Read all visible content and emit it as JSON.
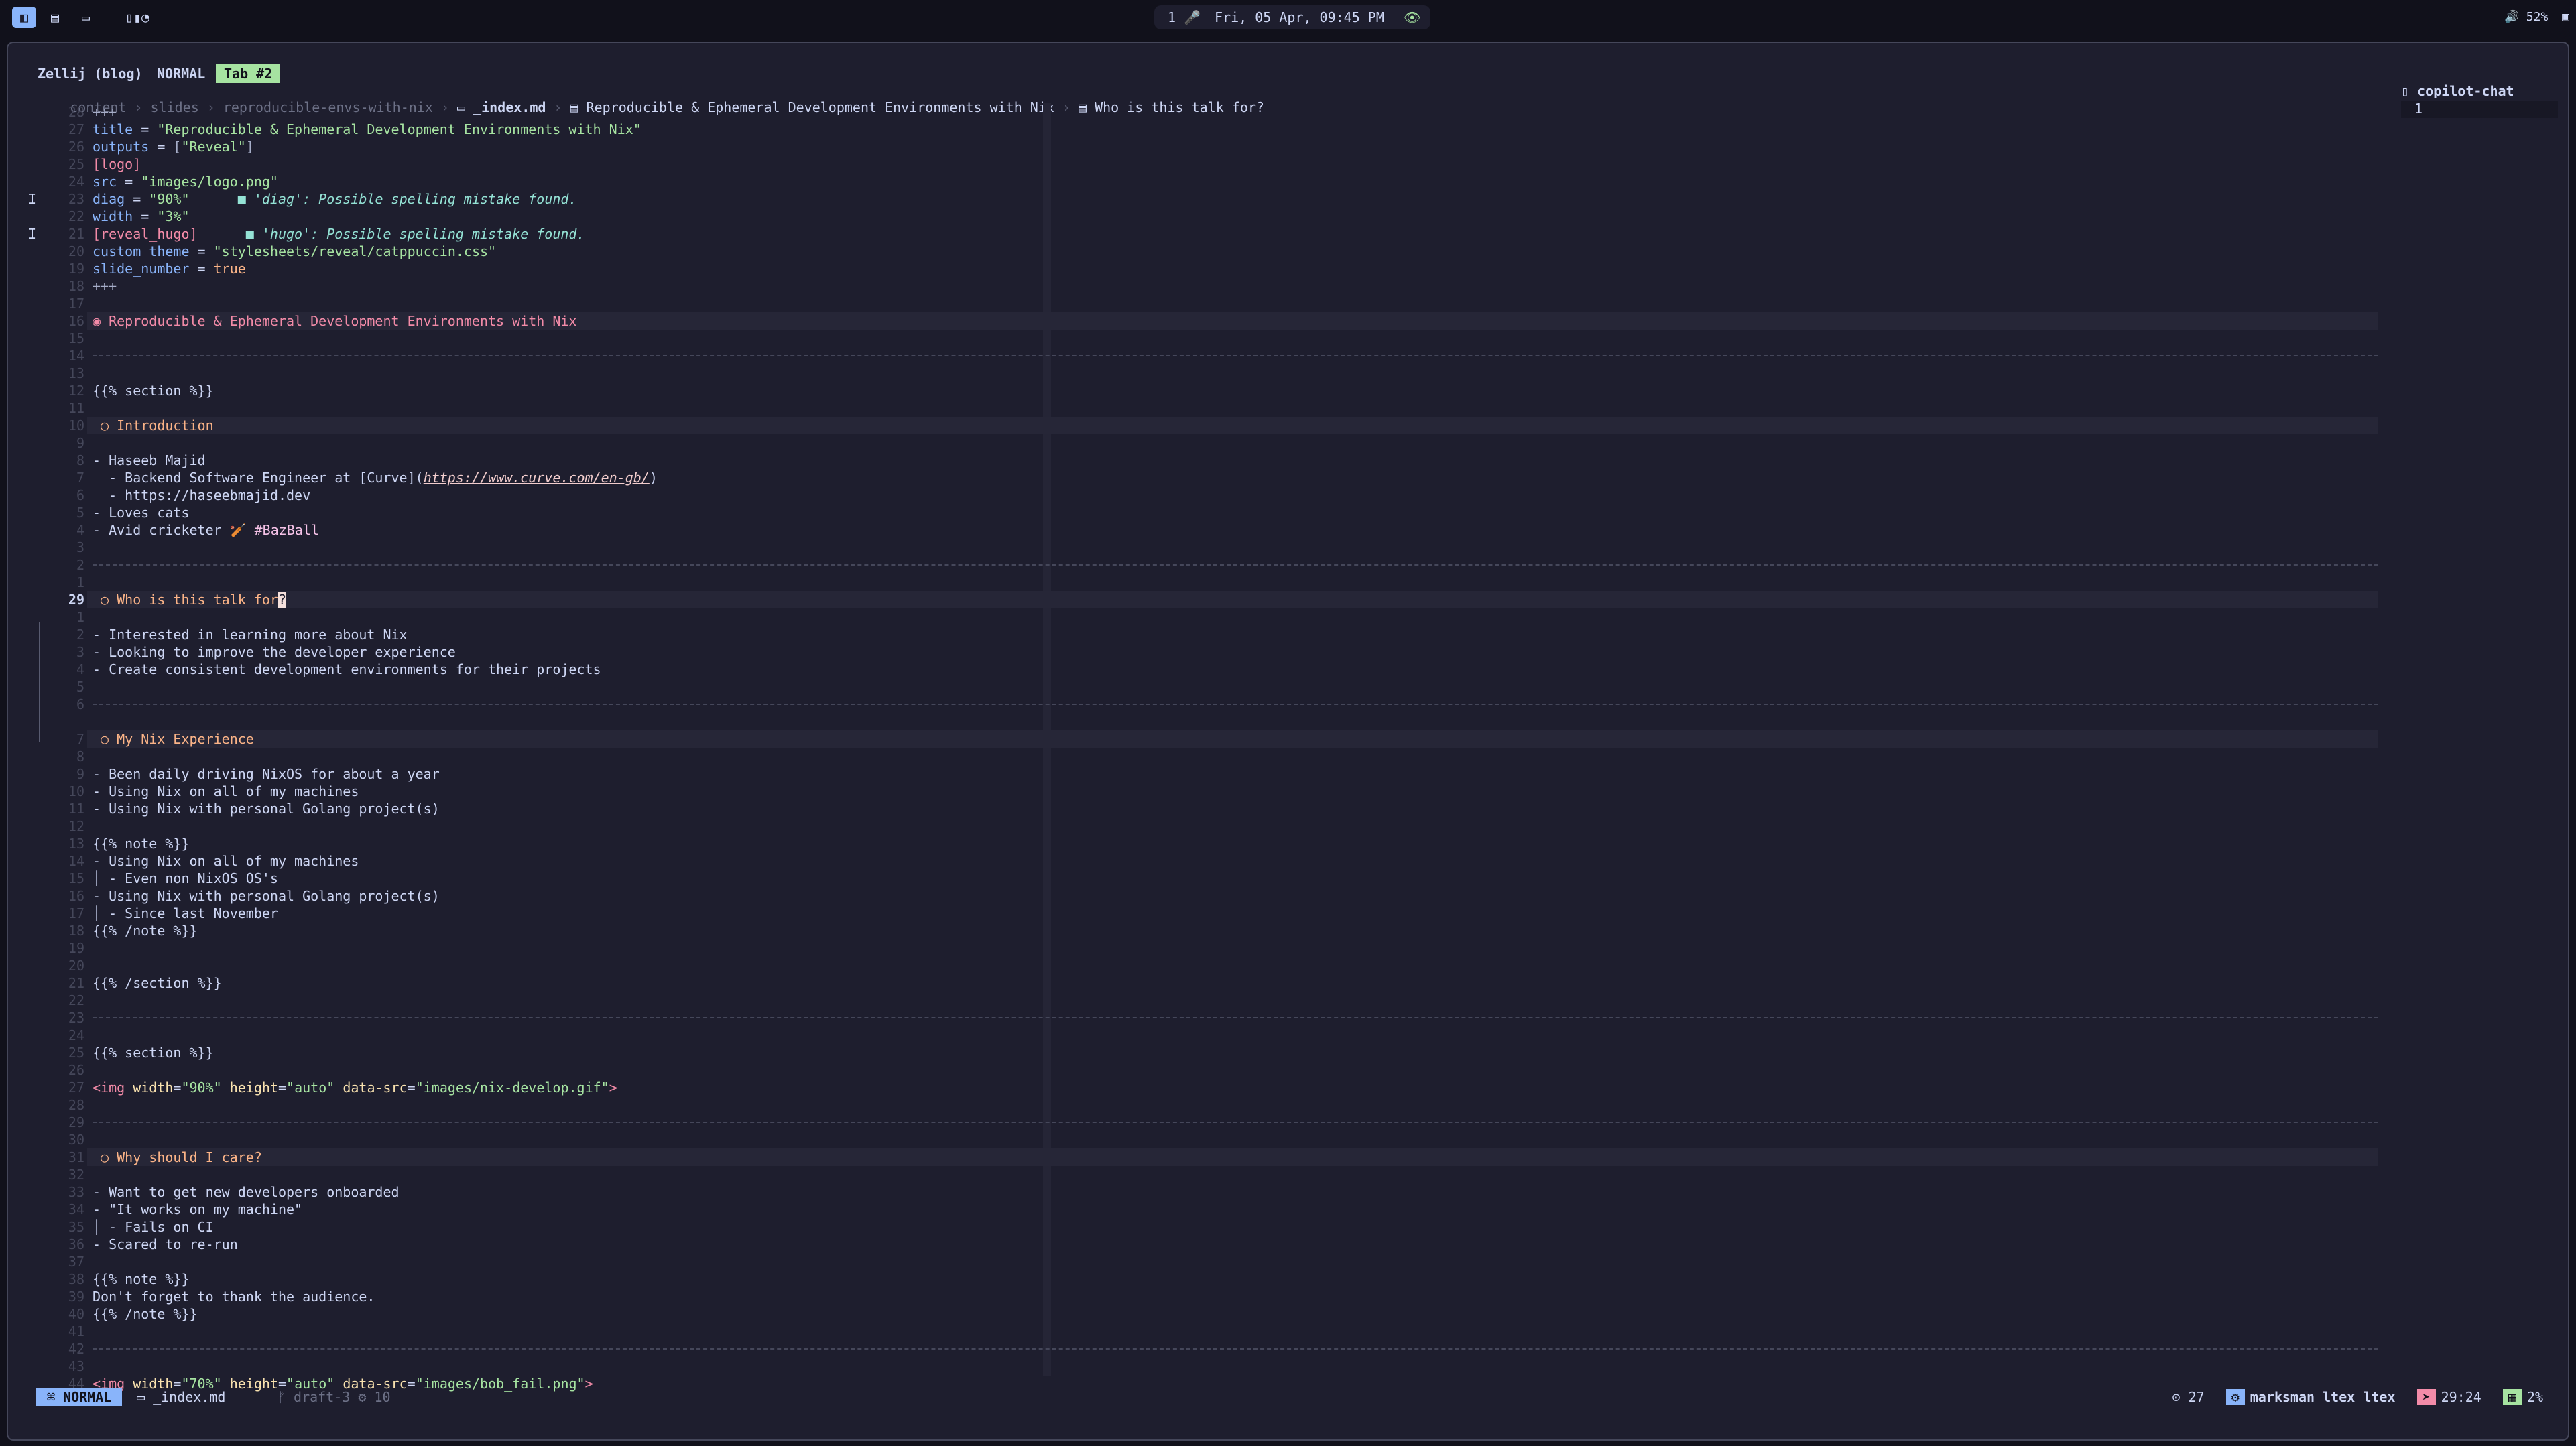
{
  "topbar": {
    "workspaces": [
      "◧",
      "▤",
      "▭",
      "▯▮◔"
    ],
    "pill": {
      "workspace": "1",
      "mic_icon": "🎤",
      "datetime": "Fri, 05 Apr, 09:45 PM",
      "eye_icon": "👁"
    },
    "volume": "52%",
    "tray_icon": "▣"
  },
  "zellij": {
    "session": "Zellij (blog)",
    "mode": "NORMAL",
    "tab": "Tab #2"
  },
  "breadcrumb": [
    "content",
    "slides",
    "reproducible-envs-with-nix",
    "_index.md",
    "Reproducible & Ephemeral Development Environments with Nix",
    "Who is this talk for?"
  ],
  "copilot": {
    "title": "copilot-chat",
    "line": "1"
  },
  "editor": {
    "current_line": "29",
    "lines": [
      {
        "ln": "28",
        "segments": [
          {
            "t": "+++",
            "c": "dim"
          }
        ]
      },
      {
        "ln": "27",
        "segments": [
          {
            "t": "title",
            "c": "key"
          },
          {
            "t": " = ",
            "c": ""
          },
          {
            "t": "\"Reproducible & Ephemeral Development Environments with Nix\"",
            "c": "str"
          }
        ]
      },
      {
        "ln": "26",
        "segments": [
          {
            "t": "outputs",
            "c": "key"
          },
          {
            "t": " = ",
            "c": ""
          },
          {
            "t": "[",
            "c": "dim"
          },
          {
            "t": "\"Reveal\"",
            "c": "str"
          },
          {
            "t": "]",
            "c": "dim"
          }
        ]
      },
      {
        "ln": "25",
        "segments": [
          {
            "t": "[logo]",
            "c": "br"
          }
        ]
      },
      {
        "ln": "24",
        "segments": [
          {
            "t": "src",
            "c": "key"
          },
          {
            "t": " = ",
            "c": ""
          },
          {
            "t": "\"images/logo.png\"",
            "c": "str"
          }
        ]
      },
      {
        "ln": "23",
        "sign": "I",
        "segments": [
          {
            "t": "diag",
            "c": "key"
          },
          {
            "t": " = ",
            "c": ""
          },
          {
            "t": "\"90%\"",
            "c": "str"
          },
          {
            "t": "      ■ 'diag': Possible spelling mistake found.",
            "c": "diag"
          }
        ]
      },
      {
        "ln": "22",
        "segments": [
          {
            "t": "width",
            "c": "key"
          },
          {
            "t": " = ",
            "c": ""
          },
          {
            "t": "\"3%\"",
            "c": "str"
          }
        ]
      },
      {
        "ln": "21",
        "sign": "I",
        "segments": [
          {
            "t": "[reveal_hugo]",
            "c": "br"
          },
          {
            "t": "      ■ 'hugo': Possible spelling mistake found.",
            "c": "diag"
          }
        ]
      },
      {
        "ln": "20",
        "segments": [
          {
            "t": "custom_theme",
            "c": "key"
          },
          {
            "t": " = ",
            "c": ""
          },
          {
            "t": "\"stylesheets/reveal/catppuccin.css\"",
            "c": "str"
          }
        ]
      },
      {
        "ln": "19",
        "segments": [
          {
            "t": "slide_number",
            "c": "key"
          },
          {
            "t": " = ",
            "c": ""
          },
          {
            "t": "true",
            "c": "bool"
          }
        ]
      },
      {
        "ln": "18",
        "segments": [
          {
            "t": "+++",
            "c": "dim"
          }
        ]
      },
      {
        "ln": "17",
        "segments": []
      },
      {
        "ln": "16",
        "hl": true,
        "segments": [
          {
            "t": "◉ Reproducible & Ephemeral Development Environments with Nix",
            "c": "h1"
          }
        ]
      },
      {
        "ln": "15",
        "segments": []
      },
      {
        "ln": "14",
        "rule": true,
        "segments": []
      },
      {
        "ln": "13",
        "segments": []
      },
      {
        "ln": "12",
        "segments": [
          {
            "t": "{{% section %}}",
            "c": ""
          }
        ]
      },
      {
        "ln": "11",
        "segments": []
      },
      {
        "ln": "10",
        "hl": true,
        "segments": [
          {
            "t": " ○ Introduction",
            "c": "h2"
          }
        ]
      },
      {
        "ln": "9",
        "segments": []
      },
      {
        "ln": "8",
        "segments": [
          {
            "t": "- Haseeb Majid",
            "c": ""
          }
        ]
      },
      {
        "ln": "7",
        "segments": [
          {
            "t": "  - Backend Software Engineer at [Curve](",
            "c": ""
          },
          {
            "t": "https://www.curve.com/en-gb/",
            "c": "link"
          },
          {
            "t": ")",
            "c": ""
          }
        ]
      },
      {
        "ln": "6",
        "segments": [
          {
            "t": "  - https://haseebmajid.dev",
            "c": ""
          }
        ]
      },
      {
        "ln": "5",
        "segments": [
          {
            "t": "- Loves cats",
            "c": ""
          }
        ]
      },
      {
        "ln": "4",
        "segments": [
          {
            "t": "- Avid cricketer 🏏 ",
            "c": ""
          },
          {
            "t": "#BazBall",
            "c": "hash"
          }
        ]
      },
      {
        "ln": "3",
        "segments": []
      },
      {
        "ln": "2",
        "rule": true,
        "segments": []
      },
      {
        "ln": "1",
        "segments": []
      },
      {
        "ln": "29",
        "cur": true,
        "hl": true,
        "segments": [
          {
            "t": " ○ Who is this talk for",
            "c": "h2"
          },
          {
            "t": "?",
            "c": "cursor"
          }
        ]
      },
      {
        "ln": "1",
        "segments": []
      },
      {
        "ln": "2",
        "segments": [
          {
            "t": "- Interested in learning more about Nix",
            "c": ""
          }
        ]
      },
      {
        "ln": "3",
        "segments": [
          {
            "t": "- Looking to improve the developer experience",
            "c": ""
          }
        ]
      },
      {
        "ln": "4",
        "segments": [
          {
            "t": "- Create consistent development environments for their projects",
            "c": ""
          }
        ]
      },
      {
        "ln": "5",
        "segments": []
      },
      {
        "ln": "6",
        "rule": true,
        "segments": []
      },
      {
        "ln": "",
        "segments": []
      },
      {
        "ln": "7",
        "hl": true,
        "segments": [
          {
            "t": " ○ My Nix Experience",
            "c": "h2"
          }
        ]
      },
      {
        "ln": "8",
        "segments": []
      },
      {
        "ln": "9",
        "segments": [
          {
            "t": "- Been daily driving NixOS for about a year",
            "c": ""
          }
        ]
      },
      {
        "ln": "10",
        "segments": [
          {
            "t": "- Using Nix on all of my machines",
            "c": ""
          }
        ]
      },
      {
        "ln": "11",
        "segments": [
          {
            "t": "- Using Nix with personal Golang project(s)",
            "c": ""
          }
        ]
      },
      {
        "ln": "12",
        "segments": []
      },
      {
        "ln": "13",
        "segments": [
          {
            "t": "{{% note %}}",
            "c": ""
          }
        ]
      },
      {
        "ln": "14",
        "segments": [
          {
            "t": "- Using Nix on all of my machines",
            "c": ""
          }
        ]
      },
      {
        "ln": "15",
        "segments": [
          {
            "t": "│ - Even non NixOS OS's",
            "c": ""
          }
        ]
      },
      {
        "ln": "16",
        "segments": [
          {
            "t": "- Using Nix with personal Golang project(s)",
            "c": ""
          }
        ]
      },
      {
        "ln": "17",
        "segments": [
          {
            "t": "│ - Since last November",
            "c": ""
          }
        ]
      },
      {
        "ln": "18",
        "segments": [
          {
            "t": "{{% /note %}}",
            "c": ""
          }
        ]
      },
      {
        "ln": "19",
        "segments": []
      },
      {
        "ln": "20",
        "segments": []
      },
      {
        "ln": "21",
        "segments": [
          {
            "t": "{{% /section %}}",
            "c": ""
          }
        ]
      },
      {
        "ln": "22",
        "segments": []
      },
      {
        "ln": "23",
        "rule": true,
        "segments": []
      },
      {
        "ln": "24",
        "segments": []
      },
      {
        "ln": "25",
        "segments": [
          {
            "t": "{{% section %}}",
            "c": ""
          }
        ]
      },
      {
        "ln": "26",
        "segments": []
      },
      {
        "ln": "27",
        "segments": [
          {
            "t": "<img",
            "c": "tag"
          },
          {
            "t": " width",
            "c": "attr"
          },
          {
            "t": "=",
            "c": ""
          },
          {
            "t": "\"90%\"",
            "c": "str"
          },
          {
            "t": " height",
            "c": "attr"
          },
          {
            "t": "=",
            "c": ""
          },
          {
            "t": "\"auto\"",
            "c": "str"
          },
          {
            "t": " data-src",
            "c": "attr"
          },
          {
            "t": "=",
            "c": ""
          },
          {
            "t": "\"images/nix-develop.gif\"",
            "c": "str"
          },
          {
            "t": ">",
            "c": "tag"
          }
        ]
      },
      {
        "ln": "28",
        "segments": []
      },
      {
        "ln": "29",
        "rule": true,
        "segments": []
      },
      {
        "ln": "30",
        "segments": []
      },
      {
        "ln": "31",
        "hl": true,
        "segments": [
          {
            "t": " ○ Why should I care?",
            "c": "h2"
          }
        ]
      },
      {
        "ln": "32",
        "segments": []
      },
      {
        "ln": "33",
        "segments": [
          {
            "t": "- Want to get new developers onboarded",
            "c": ""
          }
        ]
      },
      {
        "ln": "34",
        "segments": [
          {
            "t": "- \"It works on my machine\"",
            "c": ""
          }
        ]
      },
      {
        "ln": "35",
        "segments": [
          {
            "t": "│ - Fails on CI",
            "c": ""
          }
        ]
      },
      {
        "ln": "36",
        "segments": [
          {
            "t": "- Scared to re-run",
            "c": ""
          }
        ]
      },
      {
        "ln": "37",
        "segments": []
      },
      {
        "ln": "38",
        "segments": [
          {
            "t": "{{% note %}}",
            "c": ""
          }
        ]
      },
      {
        "ln": "39",
        "segments": [
          {
            "t": "Don't forget to thank the audience.",
            "c": ""
          }
        ]
      },
      {
        "ln": "40",
        "segments": [
          {
            "t": "{{% /note %}}",
            "c": ""
          }
        ]
      },
      {
        "ln": "41",
        "segments": []
      },
      {
        "ln": "42",
        "rule": true,
        "segments": []
      },
      {
        "ln": "43",
        "segments": []
      },
      {
        "ln": "44",
        "segments": [
          {
            "t": "<img",
            "c": "tag"
          },
          {
            "t": " width",
            "c": "attr"
          },
          {
            "t": "=",
            "c": ""
          },
          {
            "t": "\"70%\"",
            "c": "str"
          },
          {
            "t": " height",
            "c": "attr"
          },
          {
            "t": "=",
            "c": ""
          },
          {
            "t": "\"auto\"",
            "c": "str"
          },
          {
            "t": " data-src",
            "c": "attr"
          },
          {
            "t": "=",
            "c": ""
          },
          {
            "t": "\"images/bob_fail.png\"",
            "c": "str"
          },
          {
            "t": ">",
            "c": "tag"
          }
        ]
      }
    ]
  },
  "statusline": {
    "mode": "NORMAL",
    "file_icon": "▭",
    "file": "_index.md",
    "branch": "ᚠ draft-3",
    "changes": "⚙ 10",
    "count": "⊙ 27",
    "lsp_icon": "⚙",
    "lsp": "marksman ltex ltex",
    "rocket_icon": "➤",
    "position": "29:24",
    "progress_icon": "▦",
    "percent": "2%"
  },
  "colors": {
    "accent": "#89b4fa",
    "tab": "#a6e3a1",
    "heading": "#fab387",
    "background": "#1e1e2e"
  }
}
